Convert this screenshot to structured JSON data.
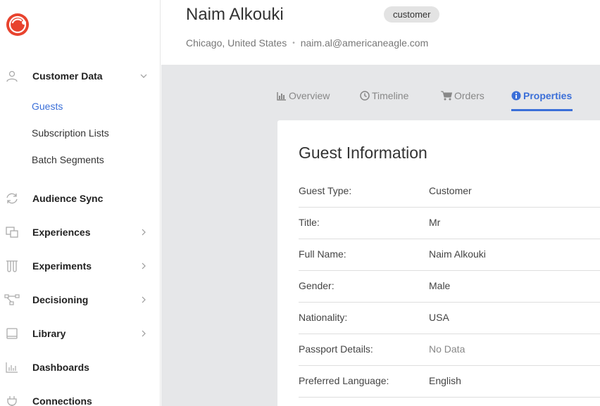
{
  "header": {
    "guest_name": "Naim Alkouki",
    "badge": "customer",
    "location": "Chicago, United States",
    "separator": "•",
    "email": "naim.al@americaneagle.com"
  },
  "sidebar": {
    "sections": [
      {
        "label": "Customer Data",
        "icon": "user-icon",
        "expanded": true
      },
      {
        "label": "Audience Sync",
        "icon": "sync-icon"
      },
      {
        "label": "Experiences",
        "icon": "experiences-icon"
      },
      {
        "label": "Experiments",
        "icon": "flask-icon"
      },
      {
        "label": "Decisioning",
        "icon": "decision-tree-icon"
      },
      {
        "label": "Library",
        "icon": "book-icon"
      },
      {
        "label": "Dashboards",
        "icon": "bar-chart-icon"
      },
      {
        "label": "Connections",
        "icon": "plug-icon"
      }
    ],
    "subitems": [
      {
        "label": "Guests",
        "active": true
      },
      {
        "label": "Subscription Lists"
      },
      {
        "label": "Batch Segments"
      }
    ]
  },
  "tabs": [
    {
      "label": "Overview",
      "icon": "chart-icon"
    },
    {
      "label": "Timeline",
      "icon": "clock-icon"
    },
    {
      "label": "Orders",
      "icon": "cart-icon"
    },
    {
      "label": "Properties",
      "icon": "info-icon",
      "active": true
    }
  ],
  "card": {
    "title": "Guest Information",
    "rows": [
      {
        "label": "Guest Type:",
        "value": "Customer"
      },
      {
        "label": "Title:",
        "value": "Mr"
      },
      {
        "label": "Full Name:",
        "value": "Naim Alkouki"
      },
      {
        "label": "Gender:",
        "value": "Male"
      },
      {
        "label": "Nationality:",
        "value": "USA"
      },
      {
        "label": "Passport Details:",
        "value": "No Data"
      },
      {
        "label": "Preferred Language:",
        "value": "English"
      }
    ]
  },
  "colors": {
    "accent": "#3b6fd8",
    "logo": "#e8432e",
    "content_bg": "#e6e7e9"
  }
}
